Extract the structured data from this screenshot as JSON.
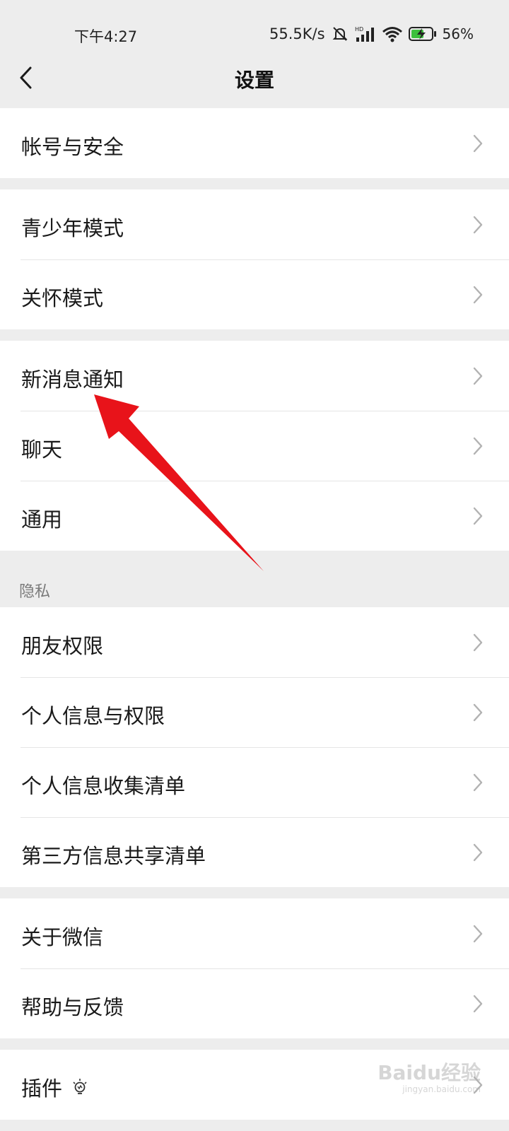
{
  "status_bar": {
    "time": "下午4:27",
    "net_speed": "55.5K/s",
    "battery_percent": "56%",
    "icons": [
      "mute-icon",
      "hd-signal-icon",
      "wifi-icon",
      "battery-charging-icon"
    ]
  },
  "header": {
    "title": "设置",
    "back_icon": "chevron-left-icon"
  },
  "groups": [
    {
      "items": [
        "帐号与安全"
      ]
    },
    {
      "items": [
        "青少年模式",
        "关怀模式"
      ]
    },
    {
      "items": [
        "新消息通知",
        "聊天",
        "通用"
      ]
    },
    {
      "section_label": "隐私",
      "items": [
        "朋友权限",
        "个人信息与权限",
        "个人信息收集清单",
        "第三方信息共享清单"
      ]
    },
    {
      "items": [
        "关于微信",
        "帮助与反馈"
      ]
    },
    {
      "items": [
        "插件"
      ]
    }
  ],
  "annotation": {
    "type": "red-arrow",
    "points_to": "新消息通知",
    "color": "#e8131a"
  },
  "watermark": {
    "text": "Baidu经验",
    "sub": "jingyan.baidu.com"
  },
  "colors": {
    "background": "#ededed",
    "surface": "#ffffff",
    "divider": "#e5e5e5",
    "chevron": "#b2b2b2",
    "section_text": "#7a7a7a"
  }
}
